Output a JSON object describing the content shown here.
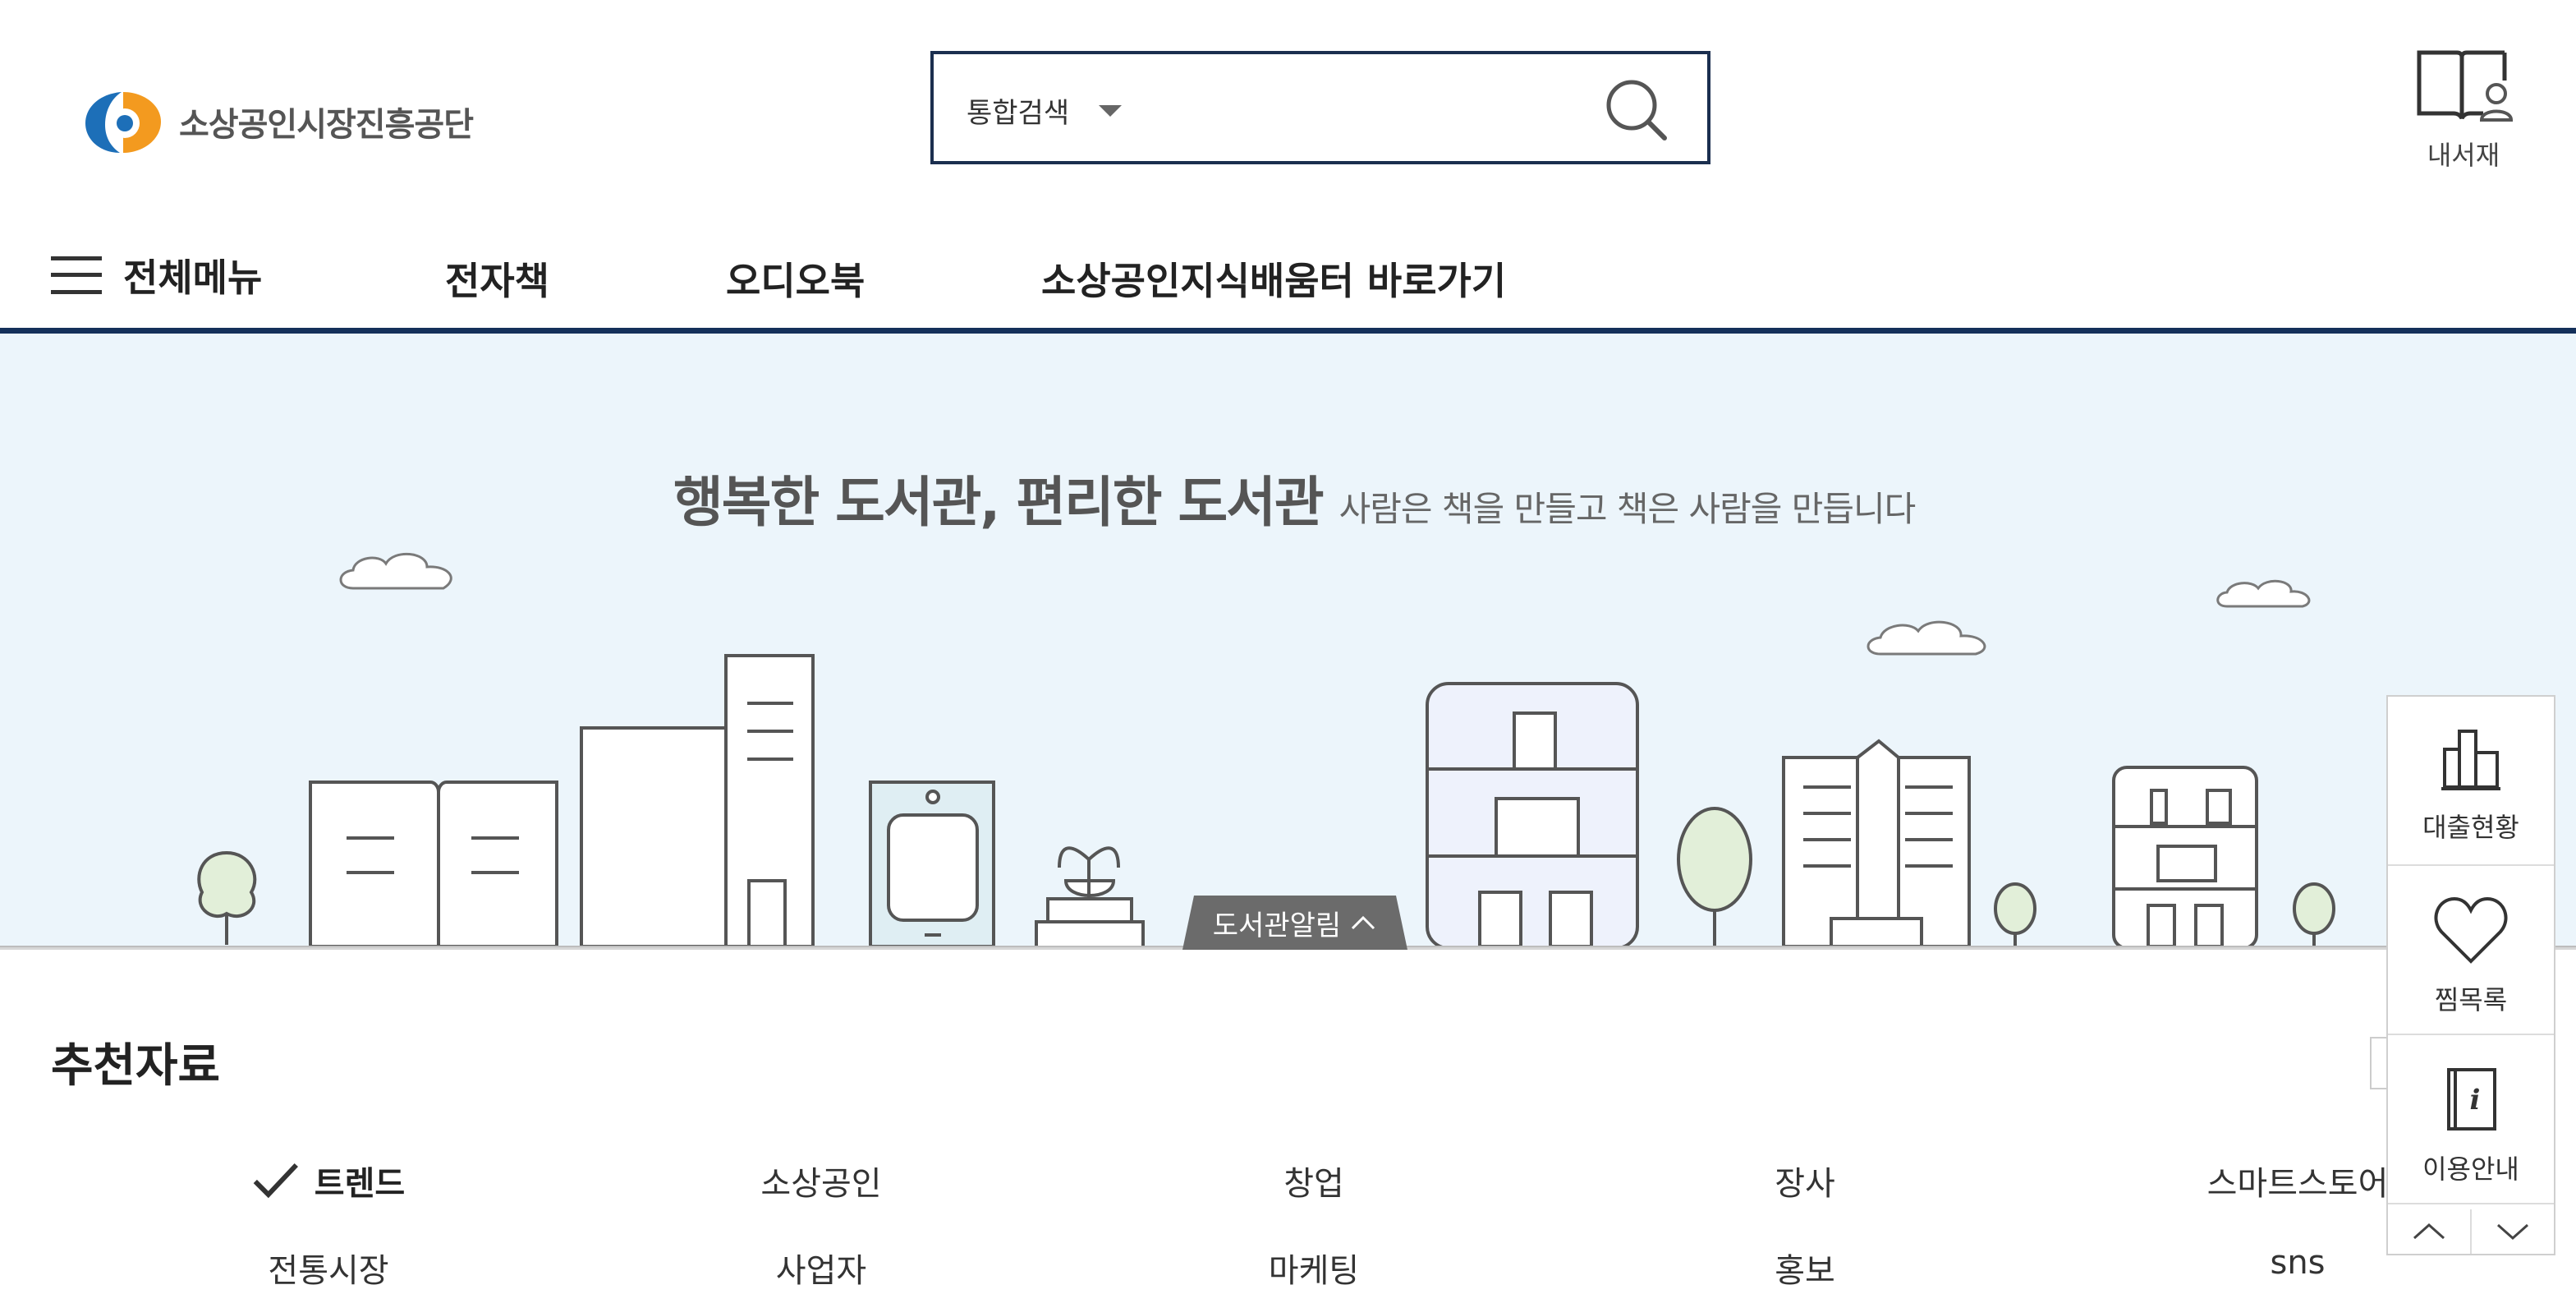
{
  "header": {
    "logo_text": "소상공인시장진흥공단",
    "search": {
      "type_label": "통합검색",
      "value": "",
      "placeholder": ""
    },
    "my_library_label": "내서재"
  },
  "nav": {
    "menu_label": "전체메뉴",
    "links": [
      "전자책",
      "오디오북",
      "소상공인지식배움터 바로가기"
    ]
  },
  "banner": {
    "title": "행복한 도서관, 편리한 도서관",
    "subtitle": "사람은 책을 만들고 책은 사람을 만듭니다",
    "notice_tab": "도서관알림"
  },
  "recommend": {
    "title": "추천자료",
    "tags_row1": [
      "트렌드",
      "소상공인",
      "창업",
      "장사",
      "스마트스토어"
    ],
    "tags_row2": [
      "전통시장",
      "사업자",
      "마케팅",
      "홍보",
      "sns"
    ],
    "active_tag": "트렌드"
  },
  "quick_menu": {
    "items": [
      "대출현황",
      "찜목록",
      "이용안내"
    ]
  },
  "colors": {
    "nav_border": "#14305a",
    "search_border": "#1b2f4f",
    "banner_bg": "#ecf5fb",
    "logo_orange": "#f39a1f",
    "logo_blue": "#1d6fb8"
  }
}
